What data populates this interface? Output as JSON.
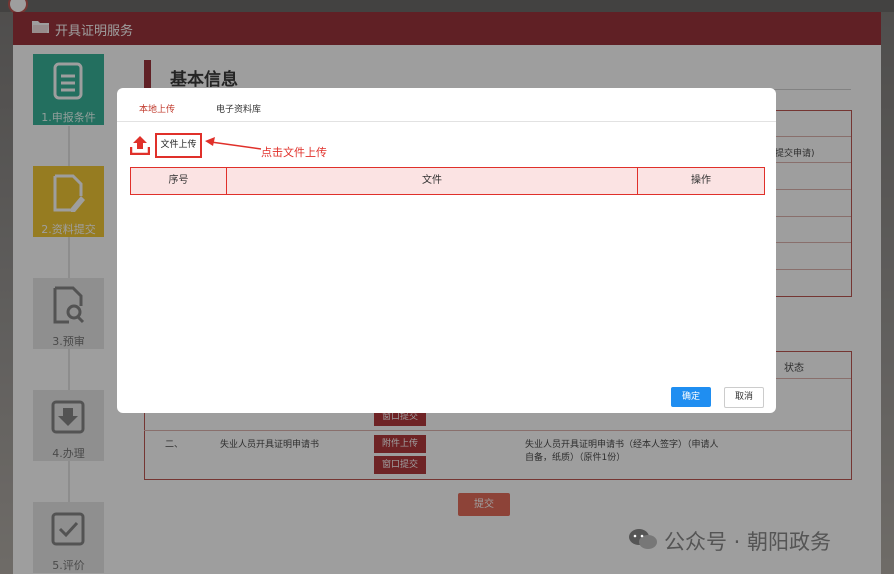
{
  "header": {
    "title": "开具证明服务",
    "icon": "folder-icon"
  },
  "steps": [
    {
      "label": "1.申报条件",
      "icon": "document-icon",
      "state": "active",
      "color": "#1fa98d"
    },
    {
      "label": "2.资料提交",
      "icon": "edit-document-icon",
      "state": "current",
      "color": "#f0c21c"
    },
    {
      "label": "3.预审",
      "icon": "search-document-icon",
      "state": "inactive"
    },
    {
      "label": "4.办理",
      "icon": "download-box-icon",
      "state": "inactive"
    },
    {
      "label": "5.评价",
      "icon": "checkbox-icon",
      "state": "inactive"
    }
  ],
  "section": {
    "title": "基本信息"
  },
  "background_table": {
    "partial_text": "提交申请)",
    "status_header": "状态",
    "rows": [
      {
        "index": "二、",
        "name": "失业人员开具证明申请书",
        "upload_label": "附件上传",
        "window_label": "窗口提交",
        "desc_line1": "失业人员开具证明申请书（经本人签字）（申请人",
        "desc_line2": "自备，纸质）（原件1份）"
      }
    ],
    "hidden_window_label": "窗口提交"
  },
  "submit_button": "提交",
  "modal": {
    "tabs": [
      {
        "label": "本地上传",
        "active": true
      },
      {
        "label": "电子资料库",
        "active": false
      }
    ],
    "upload_button": "文件上传",
    "annotation": "点击文件上传",
    "table_headers": [
      "序号",
      "文件",
      "操作"
    ],
    "ok_label": "确定",
    "cancel_label": "取消"
  },
  "watermark": "公众号 · 朝阳政务",
  "colors": {
    "brand": "#8f1b24",
    "accent_red": "#e0302a",
    "primary_blue": "#1f8ef1"
  }
}
